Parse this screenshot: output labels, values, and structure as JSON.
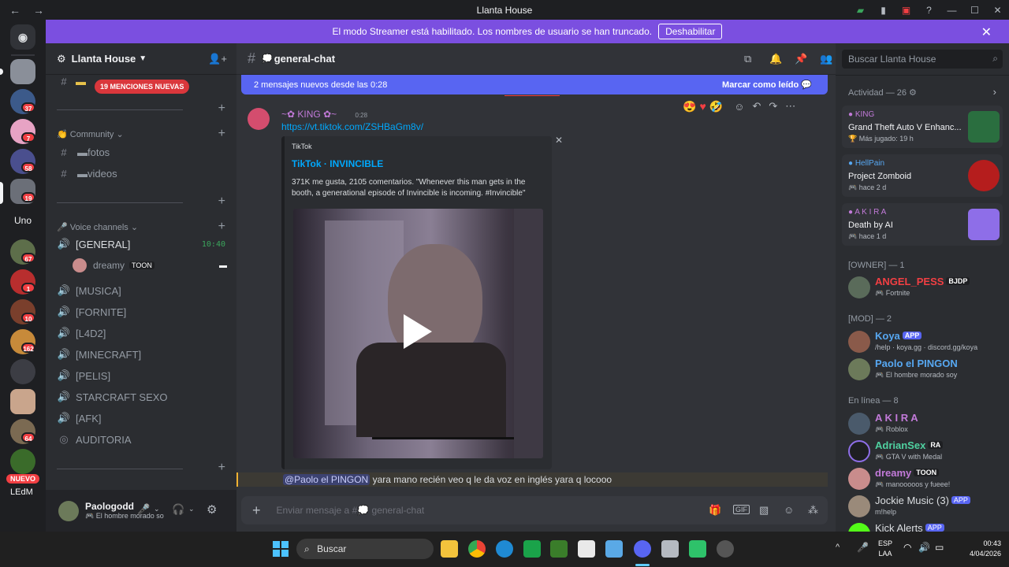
{
  "window": {
    "title": "Llanta House",
    "back": "←",
    "forward": "→"
  },
  "banner": {
    "text": "El modo Streamer está habilitado. Los nombres de usuario se han truncado.",
    "button": "Deshabilitar"
  },
  "guilds": {
    "badges": [
      "37",
      "7",
      "58",
      "19",
      "67",
      "1",
      "10",
      "162",
      "64"
    ],
    "uno_label": "Uno",
    "nuevo_label": "NUEVO",
    "partial_label": "LEdM"
  },
  "server": {
    "name": "Llanta House",
    "mentions": "19 MENCIONES NUEVAS",
    "community_label": "Community",
    "voice_label": "Voice channels",
    "text_channels": [
      {
        "name": "fotos"
      },
      {
        "name": "videos"
      }
    ],
    "general_channel": "[GENERAL]",
    "general_time": "10:40",
    "voice_user": "dreamy",
    "voice_user_tag": "TOON",
    "voice_channels": [
      "[MUSICA]",
      "[FORNITE]",
      "[L4D2]",
      "[MINECRAFT]",
      "[PELIS]",
      "STARCRAFT SEXO",
      "[AFK]",
      "AUDITORIA"
    ]
  },
  "user": {
    "name": "Paologodd",
    "status": "El hombre morado soy"
  },
  "channel": {
    "name": "general-chat",
    "new_messages": "2 mensajes nuevos desde las 0:28",
    "mark_read": "Marcar como leído"
  },
  "message": {
    "author": "KING",
    "time": "0:28",
    "link": "https://vt.tiktok.com/ZSHBaGm8v/",
    "embed_provider": "TikTok",
    "embed_title": "TikTok · INVINCIBLE",
    "embed_desc": "371K me gusta, 2105 comentarios. \"Whenever this man gets in the booth, a generational episode of Invincible is incoming. #Invincible\""
  },
  "reply": {
    "mention": "@Paolo el PINGON",
    "text": "yara mano recién veo q le da voz en inglés yara q locooo"
  },
  "composer": {
    "placeholder": "Enviar mensaje a #",
    "channel": "general-chat"
  },
  "members": {
    "search_placeholder": "Buscar Llanta House",
    "activity_header": "Actividad — 26",
    "activities": [
      {
        "user": "KING",
        "game": "Grand Theft Auto V Enhanc...",
        "detail": "Más jugado: 19 h",
        "color": "#2a6e3f"
      },
      {
        "user": "HellPain",
        "game": "Project Zomboid",
        "detail": "hace 2 d",
        "color": "#b51d1d"
      },
      {
        "user": "A K I R A",
        "game": "Death by AI",
        "detail": "hace 1 d",
        "color": "#8e6ee8"
      }
    ],
    "owner_header": "[OWNER] — 1",
    "mod_header": "[MOD] — 2",
    "online_header": "En línea — 8",
    "list": [
      {
        "name": "ANGEL_PESS",
        "tag": "BJDP",
        "status": "Fortnite",
        "color": "#f23f43"
      },
      {
        "name": "Koya",
        "tag": "APP",
        "status": "/help · koya.gg · discord.gg/koya",
        "color": "#57a8f2"
      },
      {
        "name": "Paolo el PINGON",
        "tag": "",
        "status": "El hombre morado soy",
        "color": "#57a8f2"
      },
      {
        "name": "A K I R A",
        "tag": "",
        "status": "Roblox",
        "color": "#c27ad9"
      },
      {
        "name": "AdrianSex",
        "tag": "RA",
        "status": "GTA V with Medal",
        "color": "#4fd1a0"
      },
      {
        "name": "dreamy",
        "tag": "TOON",
        "status": "manooooos y fueee!",
        "color": "#c27ad9"
      },
      {
        "name": "Jockie Music (3)",
        "tag": "APP",
        "status": "m!help",
        "color": "#dbdee1"
      },
      {
        "name": "Kick Alerts",
        "tag": "APP",
        "status": "",
        "color": "#dbdee1"
      }
    ]
  },
  "taskbar": {
    "search": "Buscar",
    "lang1": "ESP",
    "lang2": "LAA",
    "time": "00:43",
    "date": "4/04/2026"
  }
}
